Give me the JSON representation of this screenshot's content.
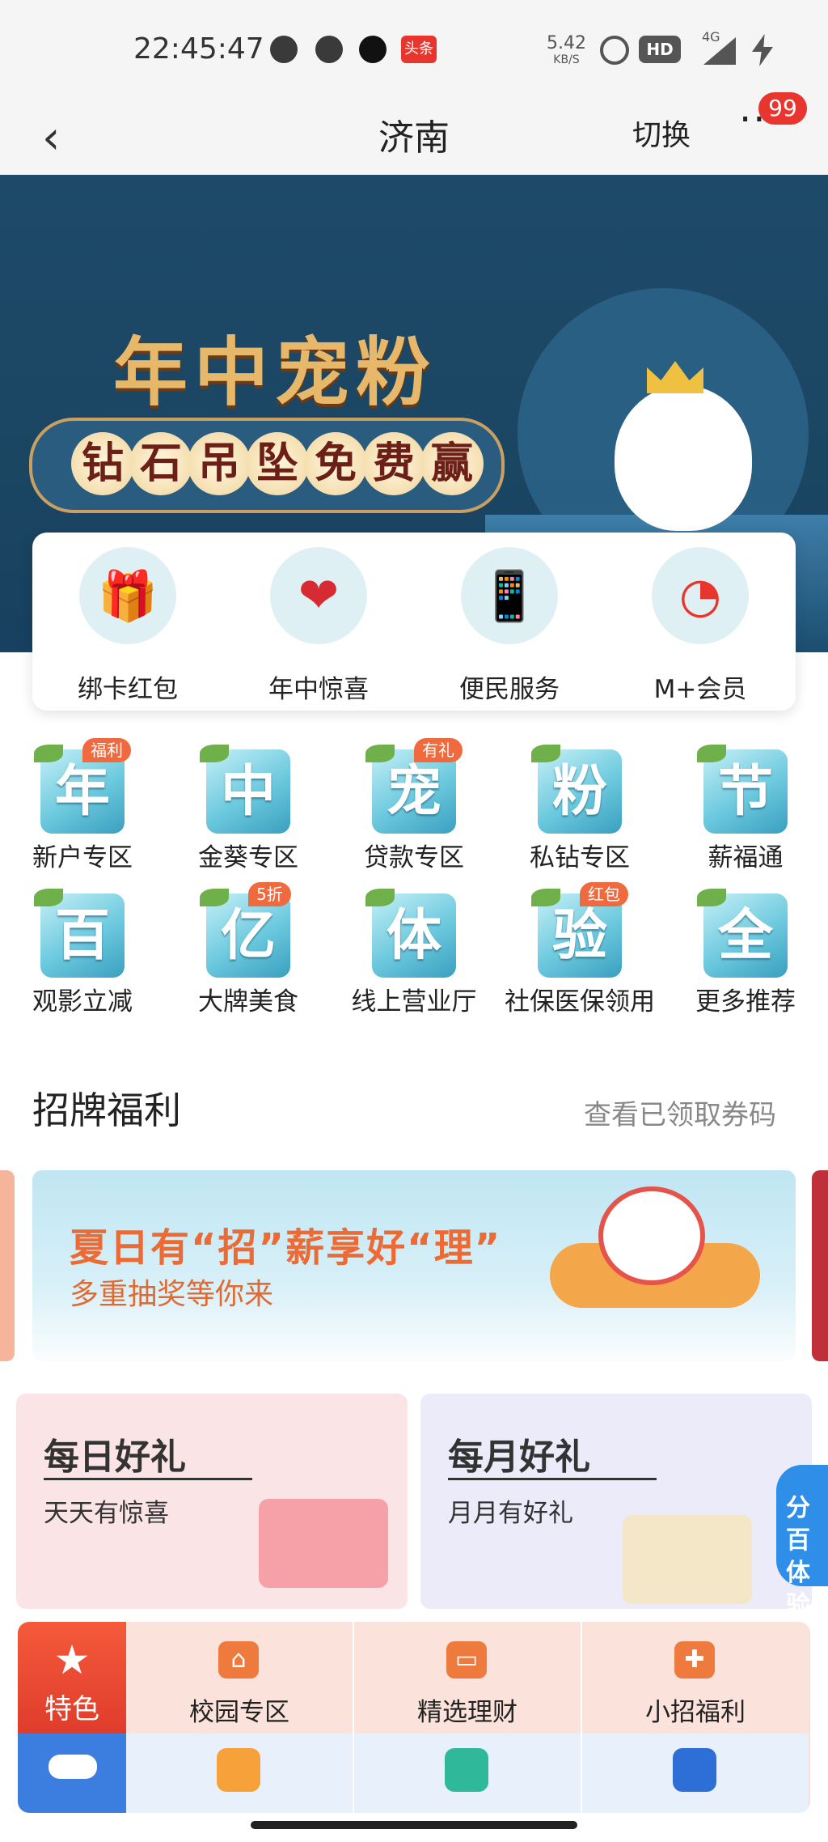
{
  "status_bar": {
    "time": "22:45:47",
    "net_speed": "5.42",
    "net_unit": "KB/S",
    "hd": "HD",
    "signal": "4G",
    "app_badge": "头条"
  },
  "nav": {
    "back_icon": "‹",
    "title": "济南",
    "switch": "切换",
    "more_icon": "···",
    "badge": "99"
  },
  "banner": {
    "headline": "年中宠粉",
    "ribbon": [
      "钻",
      "石",
      "吊",
      "坠",
      "免",
      "费",
      "赢"
    ]
  },
  "quick": [
    {
      "label": "绑卡红包",
      "icon": "gift-box-icon",
      "glyph": "🎁"
    },
    {
      "label": "年中惊喜",
      "icon": "heart-icon",
      "glyph": "❤"
    },
    {
      "label": "便民服务",
      "icon": "phone-card-icon",
      "glyph": "📱"
    },
    {
      "label": "M+会员",
      "icon": "member-hand-icon",
      "glyph": "◔"
    }
  ],
  "grid": [
    {
      "char": "年",
      "label": "新户专区",
      "tag": "福利"
    },
    {
      "char": "中",
      "label": "金葵专区",
      "tag": ""
    },
    {
      "char": "宠",
      "label": "贷款专区",
      "tag": "有礼"
    },
    {
      "char": "粉",
      "label": "私钻专区",
      "tag": ""
    },
    {
      "char": "节",
      "label": "薪福通",
      "tag": ""
    },
    {
      "char": "百",
      "label": "观影立减",
      "tag": ""
    },
    {
      "char": "亿",
      "label": "大牌美食",
      "tag": "5折"
    },
    {
      "char": "体",
      "label": "线上营业厅",
      "tag": ""
    },
    {
      "char": "验",
      "label": "社保医保领用",
      "tag": "红包"
    },
    {
      "char": "全",
      "label": "更多推荐",
      "tag": ""
    }
  ],
  "section": {
    "title": "招牌福利",
    "link": "查看已领取券码"
  },
  "promo": {
    "headline": "夏日有“招”薪享好“理”",
    "subtitle": "多重抽奖等你来"
  },
  "gifts": [
    {
      "title": "每日好礼",
      "subtitle": "天天有惊喜",
      "bg": "#fbe4e6"
    },
    {
      "title": "每月好礼",
      "subtitle": "月月有好礼",
      "bg": "#ebebfa"
    }
  ],
  "floating": {
    "line1": "分百",
    "line2": "体验"
  },
  "bottom": {
    "feature": {
      "label": "特色",
      "icon": "star-icon"
    },
    "cells": [
      {
        "label": "校园专区",
        "glyph": "⌂"
      },
      {
        "label": "精选理财",
        "glyph": "▭"
      },
      {
        "label": "小招福利",
        "glyph": "✚"
      }
    ],
    "row2_icons": [
      "car-icon",
      "didi-icon",
      "ofo-icon",
      "railway-icon"
    ]
  },
  "colors": {
    "accent": "#e8352e",
    "banner_bg": "#1e4a6a",
    "gold": "#e8b86a",
    "feature_red": "#f45a3a"
  }
}
